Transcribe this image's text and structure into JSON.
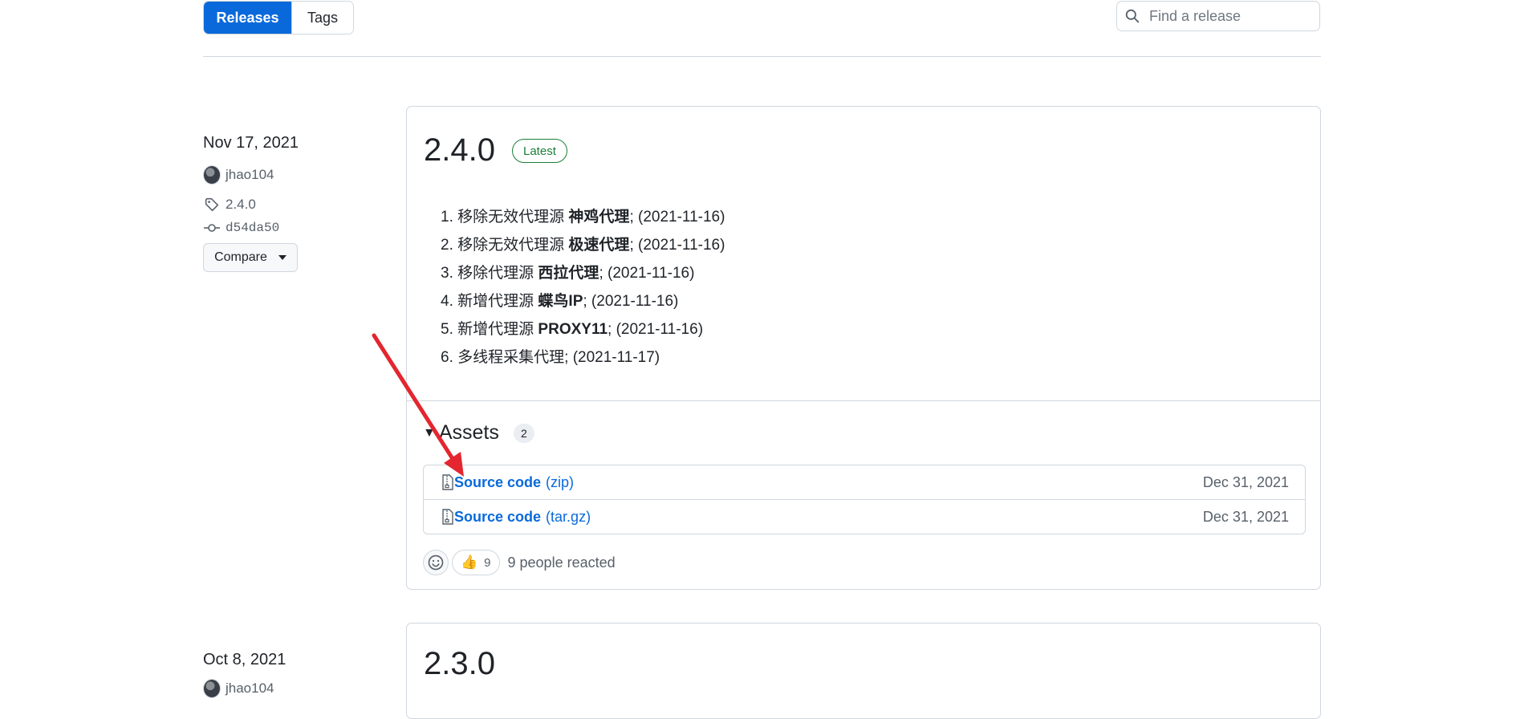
{
  "toolbar": {
    "releases_label": "Releases",
    "tags_label": "Tags",
    "search_placeholder": "Find a release"
  },
  "releases": [
    {
      "date": "Nov 17, 2021",
      "author": "jhao104",
      "tag": "2.4.0",
      "commit": "d54da50",
      "compare_label": "Compare",
      "version": "2.4.0",
      "badge": "Latest",
      "notes": [
        {
          "num": "1.",
          "pre": "移除无效代理源 ",
          "bold": "神鸡代理",
          "post": "; (2021-11-16)"
        },
        {
          "num": "2.",
          "pre": "移除无效代理源 ",
          "bold": "极速代理",
          "post": "; (2021-11-16)"
        },
        {
          "num": "3.",
          "pre": "移除代理源 ",
          "bold": "西拉代理",
          "post": "; (2021-11-16)"
        },
        {
          "num": "4.",
          "pre": "新增代理源 ",
          "bold": "蝶鸟IP",
          "post": "; (2021-11-16)"
        },
        {
          "num": "5.",
          "pre": "新增代理源 ",
          "bold": "PROXY11",
          "post": "; (2021-11-16)"
        },
        {
          "num": "6.",
          "pre": "多线程采集代理; (2021-11-17)",
          "bold": "",
          "post": ""
        }
      ],
      "assets_title": "Assets",
      "assets_count": "2",
      "assets": [
        {
          "name": "Source code",
          "ext": "(zip)",
          "date": "Dec 31, 2021"
        },
        {
          "name": "Source code",
          "ext": "(tar.gz)",
          "date": "Dec 31, 2021"
        }
      ],
      "reaction_emoji": "👍",
      "reaction_count": "9",
      "reaction_text": "9 people reacted"
    },
    {
      "date": "Oct 8, 2021",
      "author": "jhao104",
      "version": "2.3.0"
    }
  ],
  "annotation": {
    "color": "#e3262f"
  },
  "icons": {
    "search": "search-icon",
    "tag": "tag-icon",
    "commit": "commit-icon",
    "zip": "file-zip-icon",
    "smiley": "smiley-icon"
  }
}
